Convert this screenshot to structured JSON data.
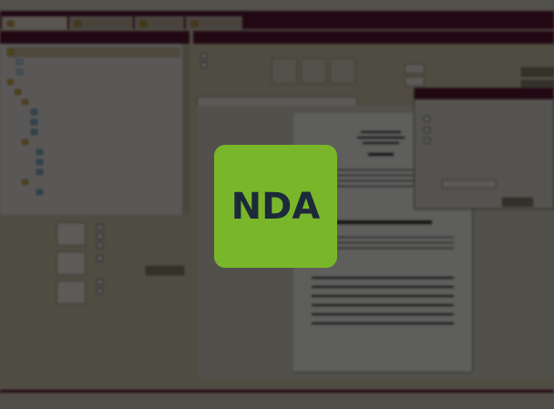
{
  "watermark": {
    "text": "NDA",
    "background": "#7ab629",
    "text_color": "#1c2a3b"
  },
  "colors": {
    "tabbar": "#5a1634",
    "panel": "#cfc7ad"
  },
  "icons": [
    "folder-icon",
    "document-icon",
    "checkbox-icon"
  ],
  "status": {
    "lock_icon": "lock-icon"
  }
}
